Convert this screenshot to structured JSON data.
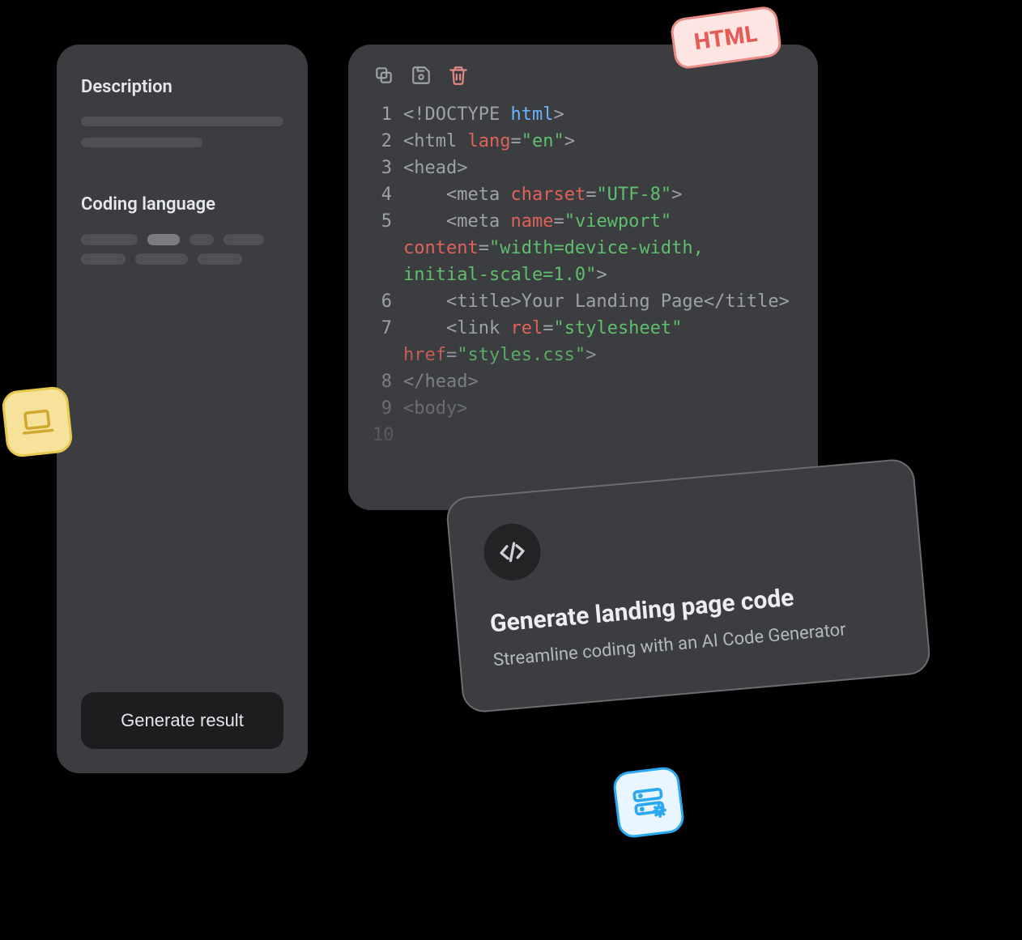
{
  "left": {
    "description_label": "Description",
    "language_label": "Coding language",
    "generate_button": "Generate result"
  },
  "badge_html": "HTML",
  "code": {
    "lines": [
      {
        "n": "1",
        "tokens": [
          [
            "bracket",
            "<!DOCTYPE "
          ],
          [
            "tag",
            "html"
          ],
          [
            "bracket",
            ">"
          ]
        ]
      },
      {
        "n": "2",
        "tokens": [
          [
            "bracket",
            "<html "
          ],
          [
            "attr",
            "lang"
          ],
          [
            "bracket",
            "="
          ],
          [
            "str",
            "\"en\""
          ],
          [
            "bracket",
            ">"
          ]
        ]
      },
      {
        "n": "3",
        "tokens": [
          [
            "bracket",
            "<head>"
          ]
        ]
      },
      {
        "n": "4",
        "tokens": [
          [
            "bracket",
            "    <meta "
          ],
          [
            "attr",
            "charset"
          ],
          [
            "bracket",
            "="
          ],
          [
            "str",
            "\"UTF-8\""
          ],
          [
            "bracket",
            ">"
          ]
        ]
      },
      {
        "n": "5",
        "tokens": [
          [
            "bracket",
            "    <meta "
          ],
          [
            "attr",
            "name"
          ],
          [
            "bracket",
            "="
          ],
          [
            "str",
            "\"viewport\""
          ],
          [
            "bracket",
            " "
          ],
          [
            "attr",
            "content"
          ],
          [
            "bracket",
            "="
          ],
          [
            "str",
            "\"width=device-width, initial-scale=1.0\""
          ],
          [
            "bracket",
            ">"
          ]
        ]
      },
      {
        "n": "6",
        "tokens": [
          [
            "bracket",
            "    <title>"
          ],
          [
            "text",
            "Your Landing Page"
          ],
          [
            "bracket",
            "</title>"
          ]
        ]
      },
      {
        "n": "7",
        "tokens": [
          [
            "bracket",
            "    <link "
          ],
          [
            "attr",
            "rel"
          ],
          [
            "bracket",
            "="
          ],
          [
            "str",
            "\"stylesheet\""
          ],
          [
            "bracket",
            " "
          ],
          [
            "attr",
            "href"
          ],
          [
            "bracket",
            "="
          ],
          [
            "str",
            "\"styles.css\""
          ],
          [
            "bracket",
            ">"
          ]
        ]
      },
      {
        "n": "8",
        "tokens": [
          [
            "bracket",
            "</head>"
          ]
        ]
      },
      {
        "n": "9",
        "tokens": [
          [
            "bracket",
            "<body>"
          ]
        ]
      },
      {
        "n": "10",
        "tokens": []
      }
    ]
  },
  "feature": {
    "title": "Generate landing page code",
    "subtitle": "Streamline coding with an AI Code Generator"
  }
}
